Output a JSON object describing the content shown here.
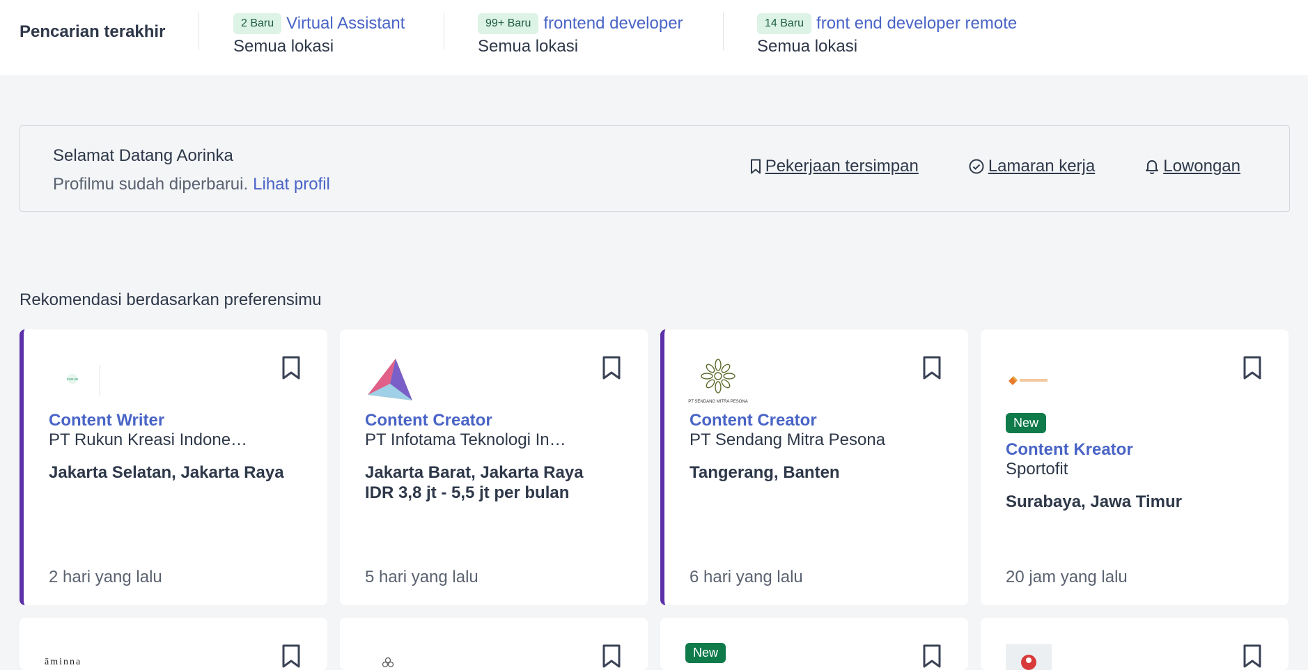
{
  "recent": {
    "title": "Pencarian terakhir",
    "items": [
      {
        "badge": "2 Baru",
        "query": "Virtual Assistant",
        "location": "Semua lokasi"
      },
      {
        "badge": "99+ Baru",
        "query": "frontend developer",
        "location": "Semua lokasi"
      },
      {
        "badge": "14 Baru",
        "query": "front end developer remote",
        "location": "Semua lokasi"
      }
    ]
  },
  "welcome": {
    "greeting": "Selamat Datang Aorinka",
    "status": "Profilmu sudah diperbarui.",
    "profile_link": "Lihat profil",
    "links": {
      "saved": "Pekerjaan tersimpan",
      "applications": "Lamaran kerja",
      "alerts": "Lowongan"
    }
  },
  "recommendations": {
    "title": "Rekomendasi berdasarkan preferensimu",
    "cards": [
      {
        "title": "Content Writer",
        "company": "PT Rukun Kreasi Indone…",
        "location": "Jakarta Selatan, Jakarta Raya",
        "time": "2 hari yang lalu"
      },
      {
        "title": "Content Creator",
        "company": "PT Infotama Teknologi In…",
        "location": "Jakarta Barat, Jakarta Raya",
        "salary": "IDR 3,8 jt - 5,5 jt per bulan",
        "time": "5 hari yang lalu"
      },
      {
        "title": "Content Creator",
        "company": "PT Sendang Mitra Pesona",
        "location": "Tangerang, Banten",
        "time": "6 hari yang lalu",
        "logo_text": "PT SENDANG MITRA PESONA"
      },
      {
        "badge": "New",
        "title": "Content Kreator",
        "company": "Sportofit",
        "location": "Surabaya, Jawa Timur",
        "time": "20 jam yang lalu"
      }
    ],
    "row2": [
      {
        "logo_text": "āminna"
      },
      {},
      {
        "badge": "New"
      },
      {}
    ]
  }
}
